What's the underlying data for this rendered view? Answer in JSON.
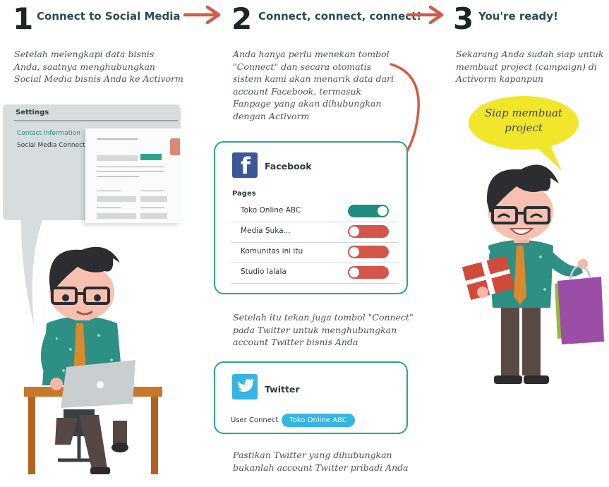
{
  "steps": [
    {
      "num": "1",
      "title": "Connect to Social Media",
      "desc": "Setelah melengkapi data bisnis\nAnda, saatnya menghubungkan\nSocial Media bisnis Anda ke Activorm"
    },
    {
      "num": "2",
      "title": "Connect, connect, connect!",
      "desc": "Anda hanya perlu menekan tombol\n\"Connect\" dan secara otomatis\nsistem kami akan menarik data dari\naccount Facebook, termasuk\nFanpage yang akan dihubungkan\ndengan Activorm"
    },
    {
      "num": "3",
      "title": "You're ready!",
      "desc": "Sekarang Anda sudah siap untuk\nmembuat project (campaign) di\nActivorm kapanpun"
    }
  ],
  "settings_panel": {
    "title": "Settings",
    "items": [
      "Contact Information",
      "Social Media Connect"
    ]
  },
  "facebook_card": {
    "title": "Facebook",
    "pages_label": "Pages",
    "pages": [
      {
        "name": "Toko Online ABC",
        "enabled": true
      },
      {
        "name": "Media Suka...",
        "enabled": false
      },
      {
        "name": "Komunitas ini itu",
        "enabled": false
      },
      {
        "name": "Studio lalala",
        "enabled": false
      }
    ]
  },
  "twitter_note": "Setelah itu tekan juga tombol \"Connect\"\npada Twitter untuk menghubungkan\naccount Twitter bisnis Anda",
  "twitter_card": {
    "title": "Twitter",
    "user_connect_label": "User Connect",
    "account": "Toko Online ABC"
  },
  "final_note": "Pastikan Twitter yang dihubungkan\nbukanlah account Twitter pribadi Anda",
  "speech_bubble": "Siap membuat\nproject",
  "colors": {
    "accent_teal": "#1f8d7f",
    "card_border": "#2aa58a",
    "toggle_off": "#d4564a",
    "arrow": "#d65a48",
    "facebook_blue": "#3b5998",
    "twitter_blue": "#35b4e6",
    "bubble_yellow": "#f2e62a"
  }
}
